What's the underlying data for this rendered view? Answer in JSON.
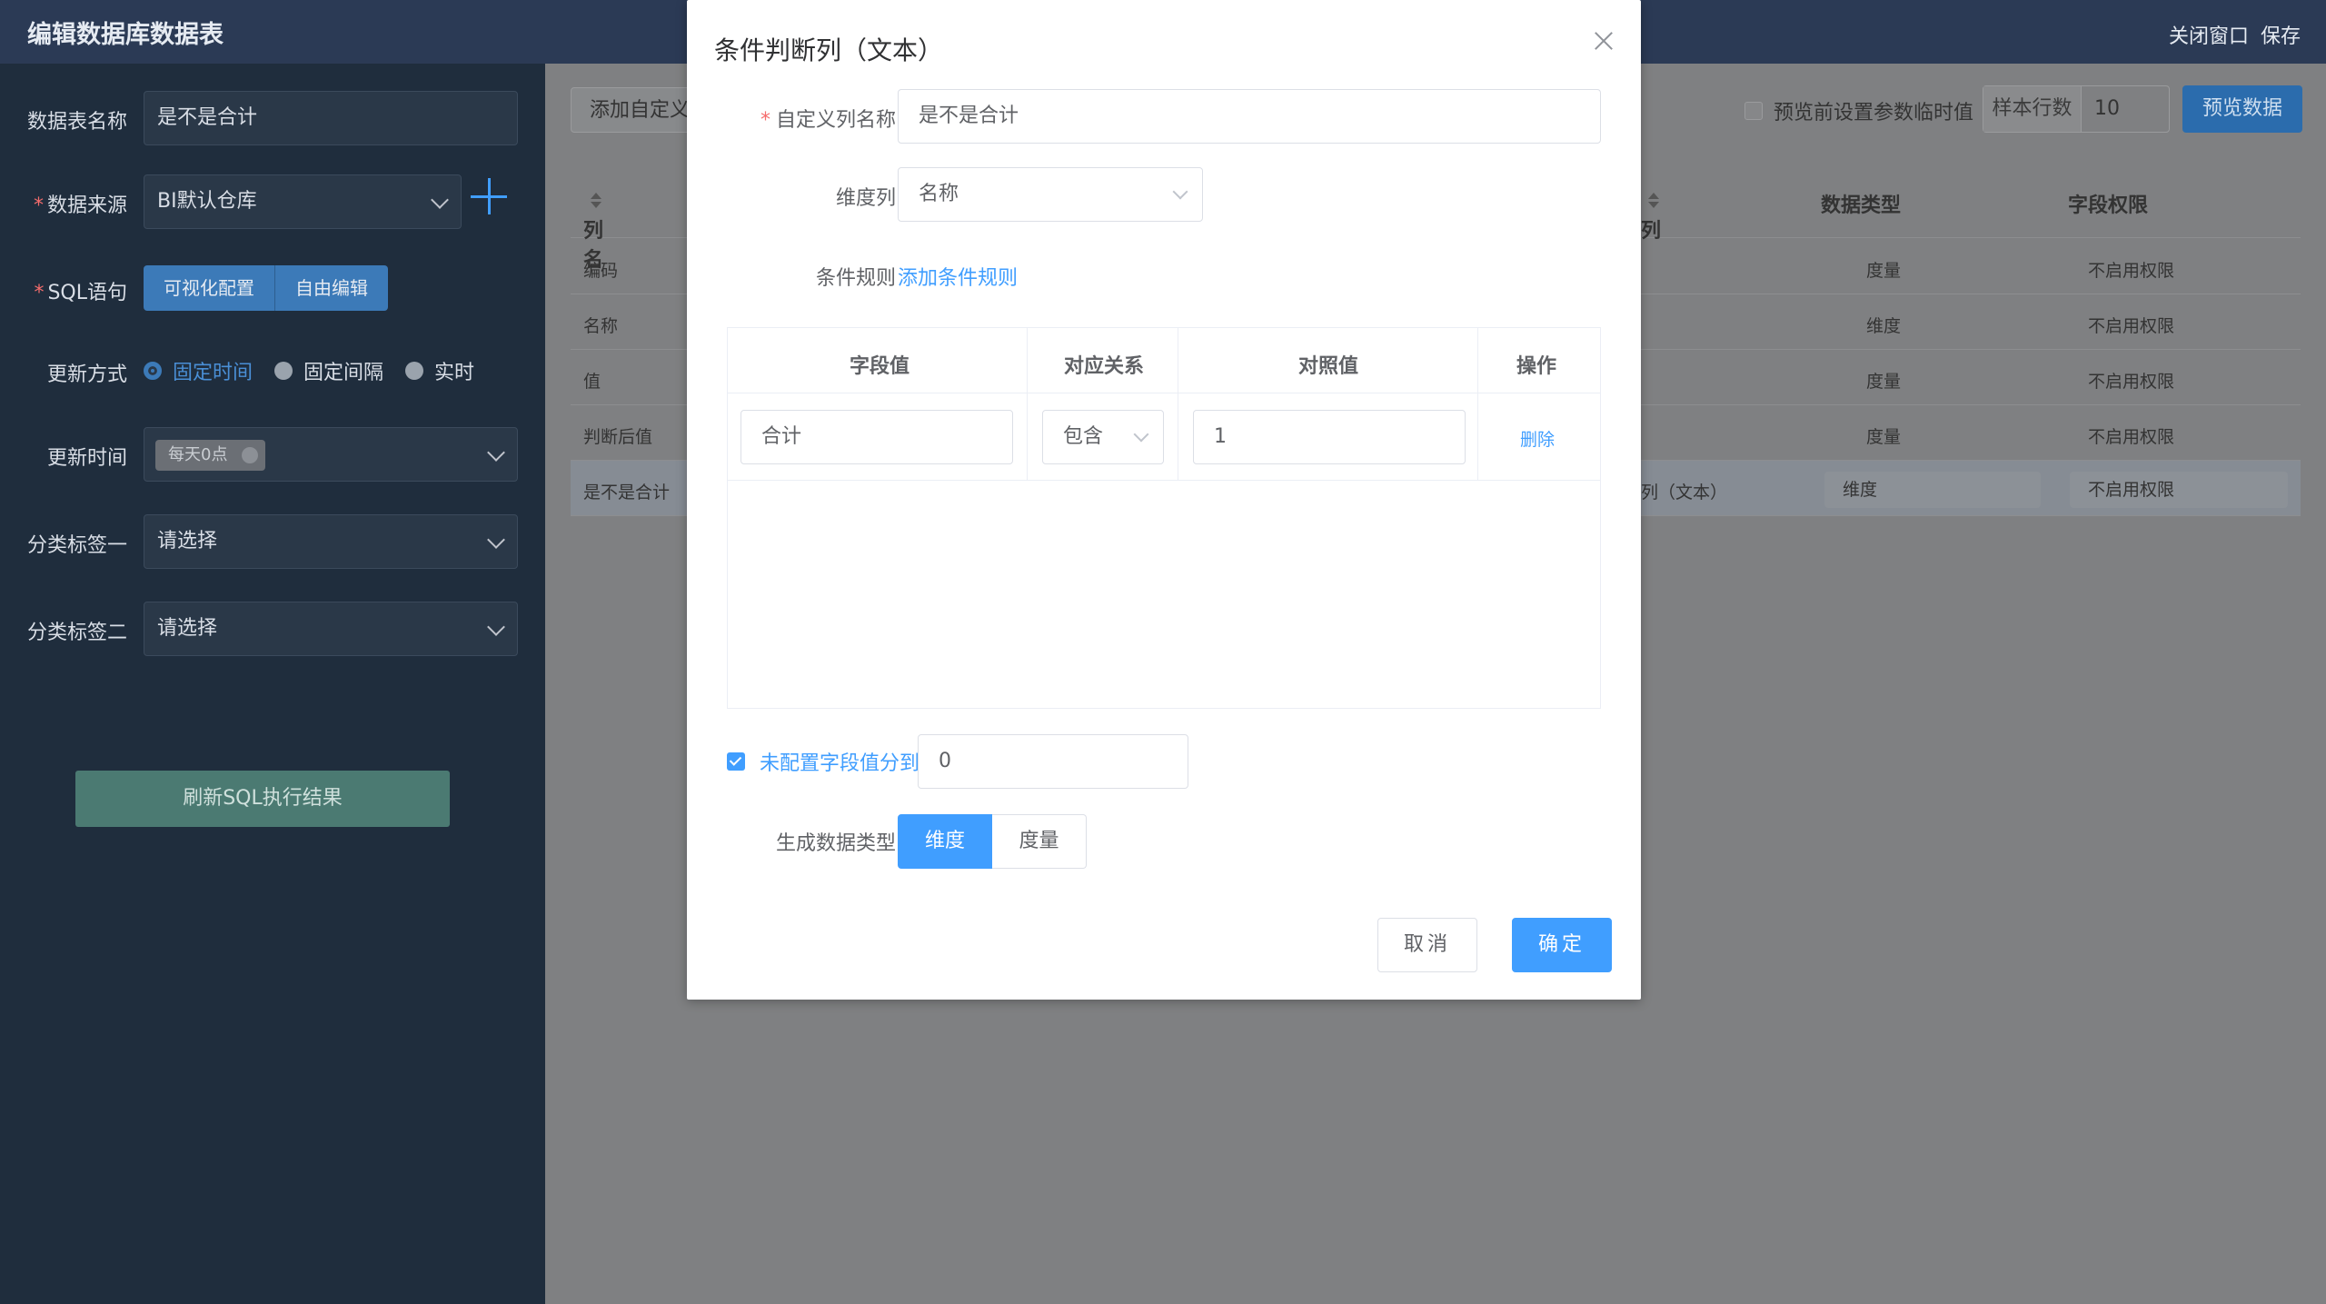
{
  "header": {
    "title": "编辑数据库数据表",
    "close_window": "关闭窗口",
    "save": "保存"
  },
  "left": {
    "table_name_label": "数据表名称",
    "table_name_value": "是不是合计",
    "source_label": "数据来源",
    "source_value": "BI默认仓库",
    "sql_label": "SQL语句",
    "sql_buttons": [
      "可视化配置",
      "自由编辑"
    ],
    "update_mode_label": "更新方式",
    "update_modes": [
      "固定时间",
      "固定间隔",
      "实时"
    ],
    "update_time_label": "更新时间",
    "update_time_tag": "每天0点",
    "category1_label": "分类标签一",
    "category1_placeholder": "请选择",
    "category2_label": "分类标签二",
    "category2_placeholder": "请选择",
    "refresh_button": "刷新SQL执行结果"
  },
  "right": {
    "add_custom_button": "添加自定义",
    "preview_param_label": "预览前设置参数临时值",
    "sample_rows_label": "样本行数",
    "sample_rows_value": "10",
    "preview_button": "预览数据",
    "columns": {
      "name": "列名",
      "col": "列",
      "data_type": "数据类型",
      "permission": "字段权限"
    },
    "rows": [
      {
        "name": "编码",
        "type": "度量",
        "perm": "不启用权限"
      },
      {
        "name": "名称",
        "type": "维度",
        "perm": "不启用权限"
      },
      {
        "name": "值",
        "type": "度量",
        "perm": "不启用权限"
      },
      {
        "name": "判断后值",
        "type": "度量",
        "perm": "不启用权限"
      },
      {
        "name": "是不是合计",
        "col": "列（文本）",
        "type": "维度",
        "perm": "不启用权限"
      }
    ]
  },
  "modal": {
    "title": "条件判断列（文本）",
    "custom_name_label": "自定义列名称",
    "custom_name_value": "是不是合计",
    "dimension_label": "维度列",
    "dimension_value": "名称",
    "rule_label": "条件规则",
    "add_rule_link": "添加条件规则",
    "table_headers": [
      "字段值",
      "对应关系",
      "对照值",
      "操作"
    ],
    "rule_row": {
      "field_value": "合计",
      "relation": "包含",
      "compare_value": "1",
      "action": "删除"
    },
    "unconfigured_label": "未配置字段值分到",
    "unconfigured_value": "0",
    "gen_type_label": "生成数据类型",
    "gen_types": [
      "维度",
      "度量"
    ],
    "cancel": "取消",
    "ok": "确定"
  }
}
